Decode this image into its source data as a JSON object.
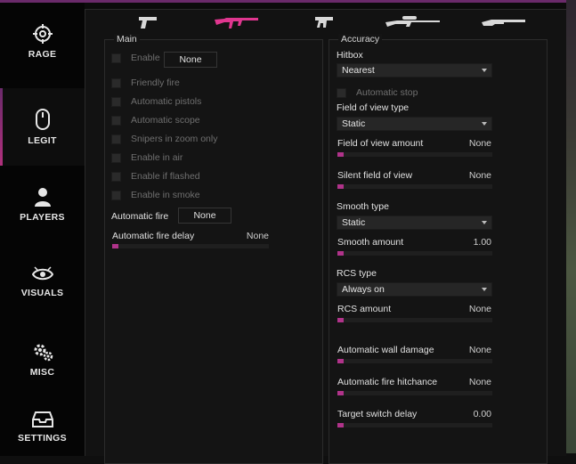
{
  "colors": {
    "accent": "#b0338a",
    "accent_dark": "#6a2a6a",
    "window_bg": "#0b0b0b",
    "panel_bg": "#141414"
  },
  "sidebar": {
    "items": [
      {
        "label": "RAGE",
        "icon": "crosshair-icon"
      },
      {
        "label": "LEGIT",
        "icon": "mouse-icon",
        "active": true
      },
      {
        "label": "PLAYERS",
        "icon": "user-icon"
      },
      {
        "label": "VISUALS",
        "icon": "eye-icon"
      },
      {
        "label": "MISC",
        "icon": "gears-icon"
      },
      {
        "label": "SETTINGS",
        "icon": "inbox-icon"
      }
    ]
  },
  "weapon_tabs": [
    {
      "icon": "pistol-icon",
      "active": false
    },
    {
      "icon": "rifle-icon",
      "active": true
    },
    {
      "icon": "smg-icon",
      "active": false
    },
    {
      "icon": "sniper-icon",
      "active": false
    },
    {
      "icon": "shotgun-icon",
      "active": false
    }
  ],
  "main": {
    "title": "Main",
    "enable": {
      "label": "Enable",
      "key_button": "None"
    },
    "checkboxes": [
      "Friendly fire",
      "Automatic pistols",
      "Automatic scope",
      "Snipers in zoom only",
      "Enable in air",
      "Enable if flashed",
      "Enable in smoke"
    ],
    "automatic_fire": {
      "label": "Automatic fire",
      "key_button": "None"
    },
    "automatic_fire_delay": {
      "label": "Automatic fire delay",
      "value": "None",
      "fill": 0.04
    }
  },
  "accuracy": {
    "title": "Accuracy",
    "hitbox": {
      "label": "Hitbox",
      "selected": "Nearest"
    },
    "automatic_stop": {
      "label": "Automatic stop"
    },
    "fov_type": {
      "label": "Field of view type",
      "selected": "Static"
    },
    "fov_amount": {
      "label": "Field of view amount",
      "value": "None",
      "fill": 0.04
    },
    "silent_fov": {
      "label": "Silent field of view",
      "value": "None",
      "fill": 0.04
    },
    "smooth_type": {
      "label": "Smooth type",
      "selected": "Static"
    },
    "smooth_amount": {
      "label": "Smooth amount",
      "value": "1.00",
      "fill": 0.04
    },
    "rcs_type": {
      "label": "RCS type",
      "selected": "Always on"
    },
    "rcs_amount": {
      "label": "RCS amount",
      "value": "None",
      "fill": 0.04
    },
    "auto_wall_damage": {
      "label": "Automatic wall damage",
      "value": "None",
      "fill": 0.04
    },
    "auto_fire_hitchance": {
      "label": "Automatic fire hitchance",
      "value": "None",
      "fill": 0.04
    },
    "target_switch_delay": {
      "label": "Target switch delay",
      "value": "0.00",
      "fill": 0.04
    }
  }
}
